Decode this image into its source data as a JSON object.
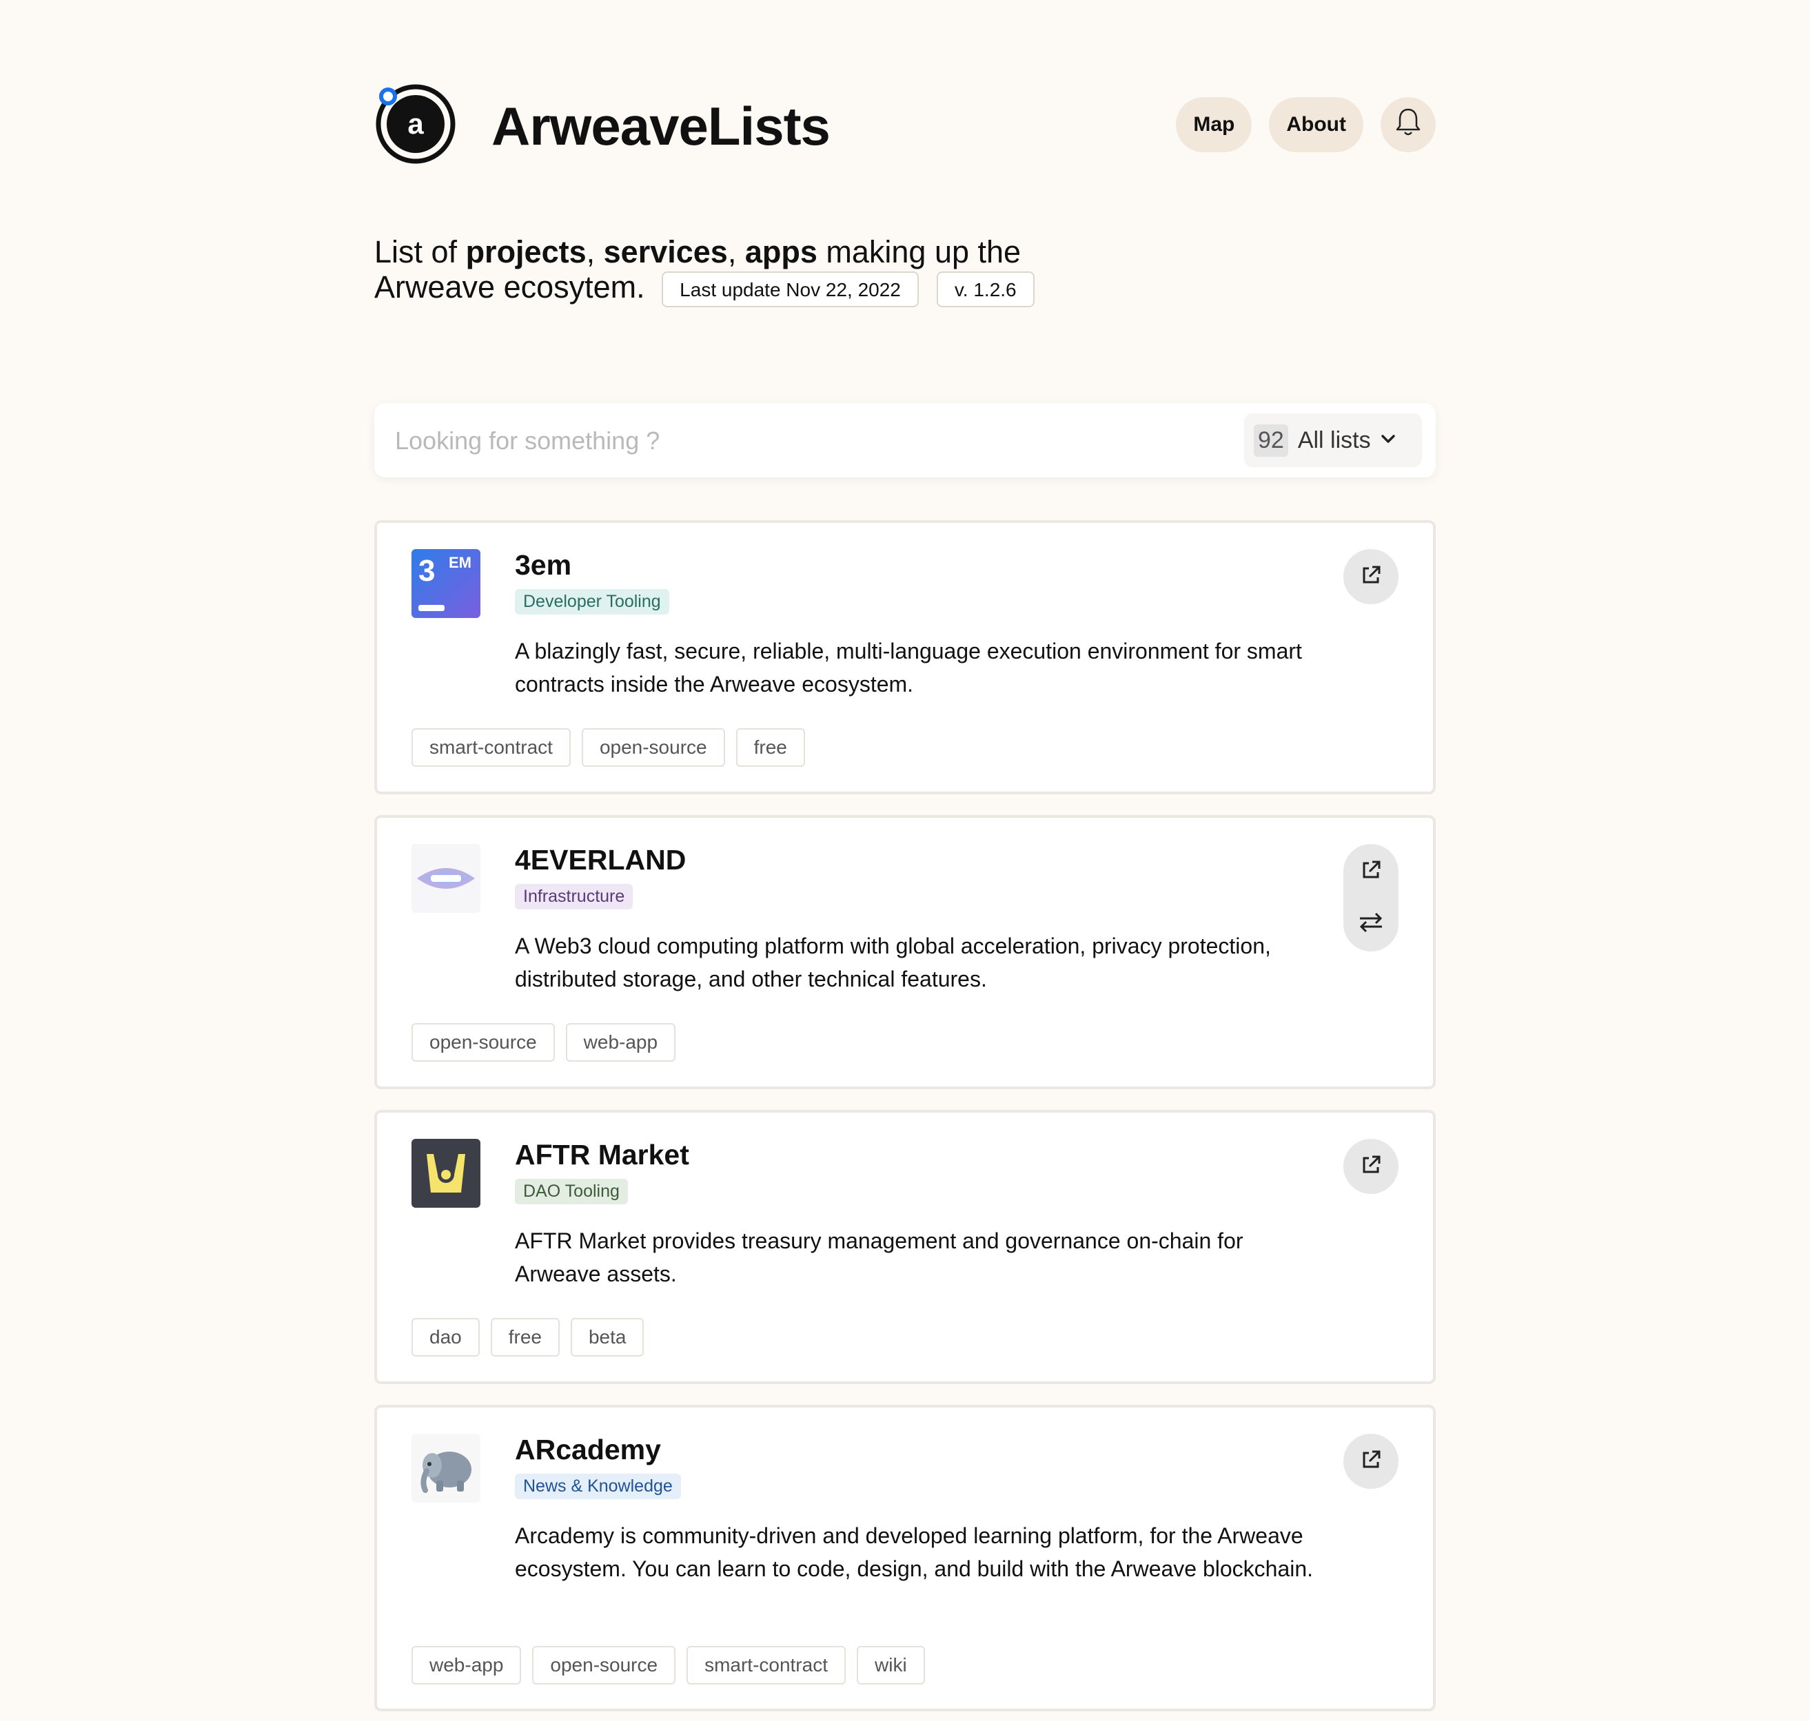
{
  "header": {
    "brand": "ArweaveLists",
    "logo_letter": "a",
    "nav": {
      "map": "Map",
      "about": "About"
    },
    "bell_icon": "bell-icon"
  },
  "intro": {
    "prefix": "List of ",
    "projects": "projects",
    "comma1": ", ",
    "services": "services",
    "comma2": ", ",
    "apps": "apps",
    "suffix": " making up the",
    "line2": "Arweave ecosytem.",
    "last_update": "Last update Nov 22, 2022",
    "version": "v. 1.2.6"
  },
  "search": {
    "placeholder": "Looking for something ?",
    "count": "92",
    "list_label": "All lists",
    "chevron_icon": "chevron-down-icon"
  },
  "cards": [
    {
      "title": "3em",
      "category": "Developer Tooling",
      "description": "A blazingly fast, secure, reliable, multi-language execution environment for smart contracts inside the Arweave ecosystem.",
      "tags": [
        "smart-contract",
        "open-source",
        "free"
      ],
      "icon_text": "3",
      "icon_sup": "EM"
    },
    {
      "title": "4EVERLAND",
      "category": "Infrastructure",
      "description": "A Web3 cloud computing platform with global acceleration, privacy protection, distributed storage, and other technical features.",
      "tags": [
        "open-source",
        "web-app"
      ]
    },
    {
      "title": "AFTR Market",
      "category": "DAO Tooling",
      "description": "AFTR Market provides treasury management and governance on-chain for Arweave assets.",
      "tags": [
        "dao",
        "free",
        "beta"
      ]
    },
    {
      "title": "ARcademy",
      "category": "News & Knowledge",
      "description": "Arcademy is community-driven and developed learning platform, for the Arweave ecosystem. You can learn to code, design, and build with the Arweave blockchain.",
      "tags": [
        "web-app",
        "open-source",
        "smart-contract",
        "wiki"
      ]
    }
  ],
  "colors": {
    "background": "#fdfaf6",
    "nav_pill": "#f1e8db",
    "logo_dot": "#1a73e8",
    "cat_dev_bg": "#e0f2ef",
    "cat_dev_fg": "#2a6e63",
    "cat_infra_bg": "#efe7f5",
    "cat_infra_fg": "#5a3a78",
    "cat_dao_bg": "#e3ede2",
    "cat_dao_fg": "#3d5a3b",
    "cat_news_bg": "#e5effa",
    "cat_news_fg": "#1f5396"
  }
}
